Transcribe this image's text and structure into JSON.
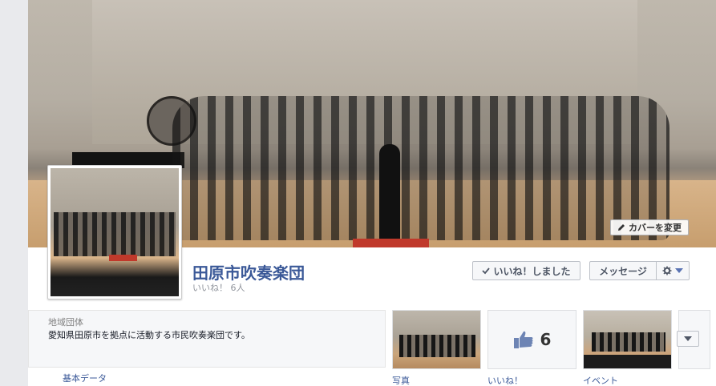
{
  "cover": {
    "change_cover_label": "カバーを変更",
    "change_cover_icon": "pencil-icon"
  },
  "page": {
    "title": "田原市吹奏楽団",
    "likes": "いいね！ 6人"
  },
  "actions": {
    "like_label": "いいね！しました",
    "like_icon": "checkmark-icon",
    "message_label": "メッセージ",
    "gear_icon": "gear-icon",
    "dropdown_icon": "chevron-down-icon"
  },
  "about": {
    "category": "地域団体",
    "description": "愛知県田原市を拠点に活動する市民吹奏楽団です。",
    "basic_data_link": "基本データ"
  },
  "apps": {
    "photos_label": "写真",
    "likes_label": "いいね！",
    "likes_count": "6",
    "likes_icon": "thumbs-up-icon",
    "events_label": "イベント"
  },
  "colors": {
    "brand_blue": "#3b5998",
    "rug_red": "#c0392b"
  }
}
